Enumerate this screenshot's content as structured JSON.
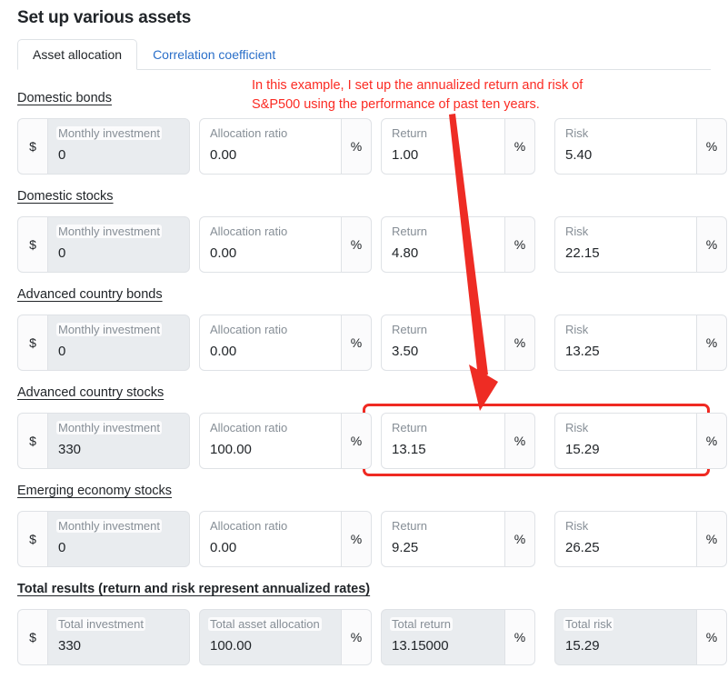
{
  "page_title": "Set up various assets",
  "tabs": [
    {
      "label": "Asset allocation",
      "active": true
    },
    {
      "label": "Correlation coefficient",
      "active": false
    }
  ],
  "annotation": {
    "line1": "In this example, I set up the annualized return and risk of",
    "line2": "S&P500 using the performance of past ten years.",
    "color": "#fb2b23"
  },
  "addons": {
    "currency": "$",
    "percent": "%"
  },
  "labels": {
    "monthly_investment": "Monthly investment",
    "allocation_ratio": "Allocation ratio",
    "return": "Return",
    "risk": "Risk",
    "total_investment": "Total investment",
    "total_asset_allocation": "Total asset allocation",
    "total_return": "Total return",
    "total_risk": "Total risk"
  },
  "sections": [
    {
      "title": "Domestic bonds",
      "monthly_investment": "0",
      "allocation_ratio": "0.00",
      "return": "1.00",
      "risk": "5.40"
    },
    {
      "title": "Domestic stocks",
      "monthly_investment": "0",
      "allocation_ratio": "0.00",
      "return": "4.80",
      "risk": "22.15"
    },
    {
      "title": "Advanced country bonds",
      "monthly_investment": "0",
      "allocation_ratio": "0.00",
      "return": "3.50",
      "risk": "13.25"
    },
    {
      "title": "Advanced country stocks",
      "monthly_investment": "330",
      "allocation_ratio": "100.00",
      "return": "13.15",
      "risk": "15.29"
    },
    {
      "title": "Emerging economy stocks",
      "monthly_investment": "0",
      "allocation_ratio": "0.00",
      "return": "9.25",
      "risk": "26.25"
    }
  ],
  "total": {
    "title": "Total results (return and risk represent annualized rates)",
    "total_investment": "330",
    "total_asset_allocation": "100.00",
    "total_return": "13.15000",
    "total_risk": "15.29"
  }
}
